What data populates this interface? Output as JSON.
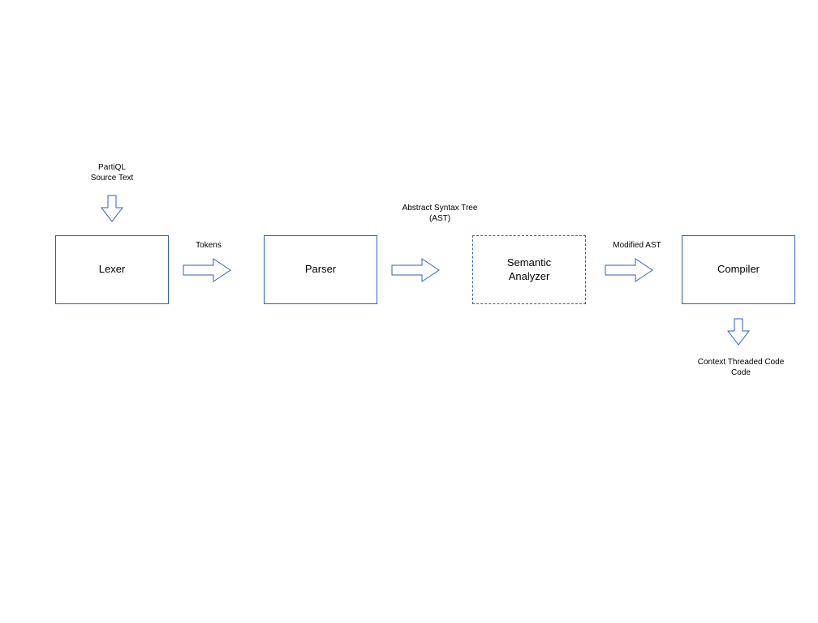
{
  "input_label_line1": "PartiQL",
  "input_label_line2": "Source Text",
  "nodes": {
    "lexer": "Lexer",
    "parser": "Parser",
    "semantic_line1": "Semantic",
    "semantic_line2": "Analyzer",
    "compiler": "Compiler"
  },
  "edge_labels": {
    "tokens": "Tokens",
    "ast_line1": "Abstract Syntax Tree",
    "ast_line2": "(AST)",
    "modified_ast": "Modified AST"
  },
  "output_label_line1": "Context Threaded Code",
  "output_label_line2": "Code",
  "colors": {
    "stroke": "#2b5fca",
    "fill": "#ffffff"
  }
}
